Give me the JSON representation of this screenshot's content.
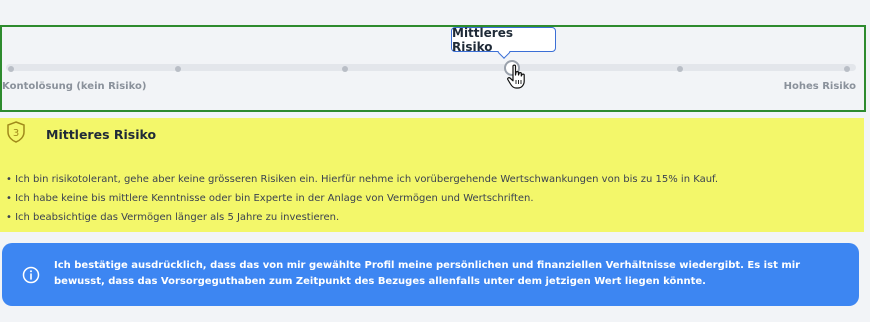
{
  "slider": {
    "tooltip_label": "Mittleres Risiko",
    "left_label": "Kontolösung (kein Risiko)",
    "right_label": "Hohes Risiko",
    "selected_step": 4,
    "step_count": 7
  },
  "risk_profile": {
    "badge_number": "3",
    "title": "Mittleres Risiko",
    "bullets": [
      "Ich bin risikotolerant, gehe aber keine grösseren Risiken ein. Hierfür nehme ich vorübergehende Wertschwankungen von bis zu 15% in Kauf.",
      "Ich habe keine bis mittlere Kenntnisse oder bin Experte in der Anlage von Vermögen und Wertschriften.",
      "Ich beabsichtige das Vermögen länger als 5 Jahre zu investieren."
    ]
  },
  "confirmation": {
    "text": "Ich bestätige ausdrücklich, dass das von mir gewählte Profil meine persönlichen und finanziellen Verhältnisse wiedergibt. Es ist mir bewusst, dass das Vorsorgeguthaben zum Zeitpunkt des Bezuges allenfalls unter dem jetzigen Wert liegen könnte."
  },
  "colors": {
    "highlight_border": "#2e8b2e",
    "risk_panel": "#f3f76a",
    "info_box": "#3d86f2",
    "tooltip_border": "#3b6fd6"
  }
}
